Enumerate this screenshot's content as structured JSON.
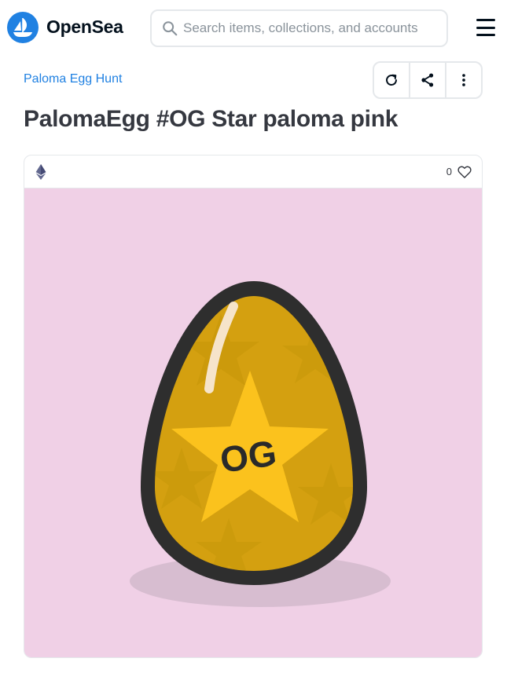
{
  "header": {
    "brand": "OpenSea",
    "search": {
      "placeholder": "Search items, collections, and accounts",
      "value": ""
    },
    "icons": {
      "logo": "opensea-logo-icon",
      "search": "search-icon",
      "menu": "hamburger-menu-icon"
    }
  },
  "item": {
    "collection": "Paloma Egg Hunt",
    "title": "PalomaEgg #OG Star paloma pink",
    "chain_icon": "ethereum-icon",
    "favorites": "0",
    "actions": [
      "refresh-icon",
      "share-icon",
      "more-options-icon"
    ],
    "artwork": {
      "label": "OG",
      "background": "#F0D0E6",
      "egg_color": "#D4A010",
      "star_color": "#FBC21D"
    }
  },
  "colors": {
    "accent": "#2081E2",
    "border": "#e5e8eb",
    "text": "#353840"
  }
}
